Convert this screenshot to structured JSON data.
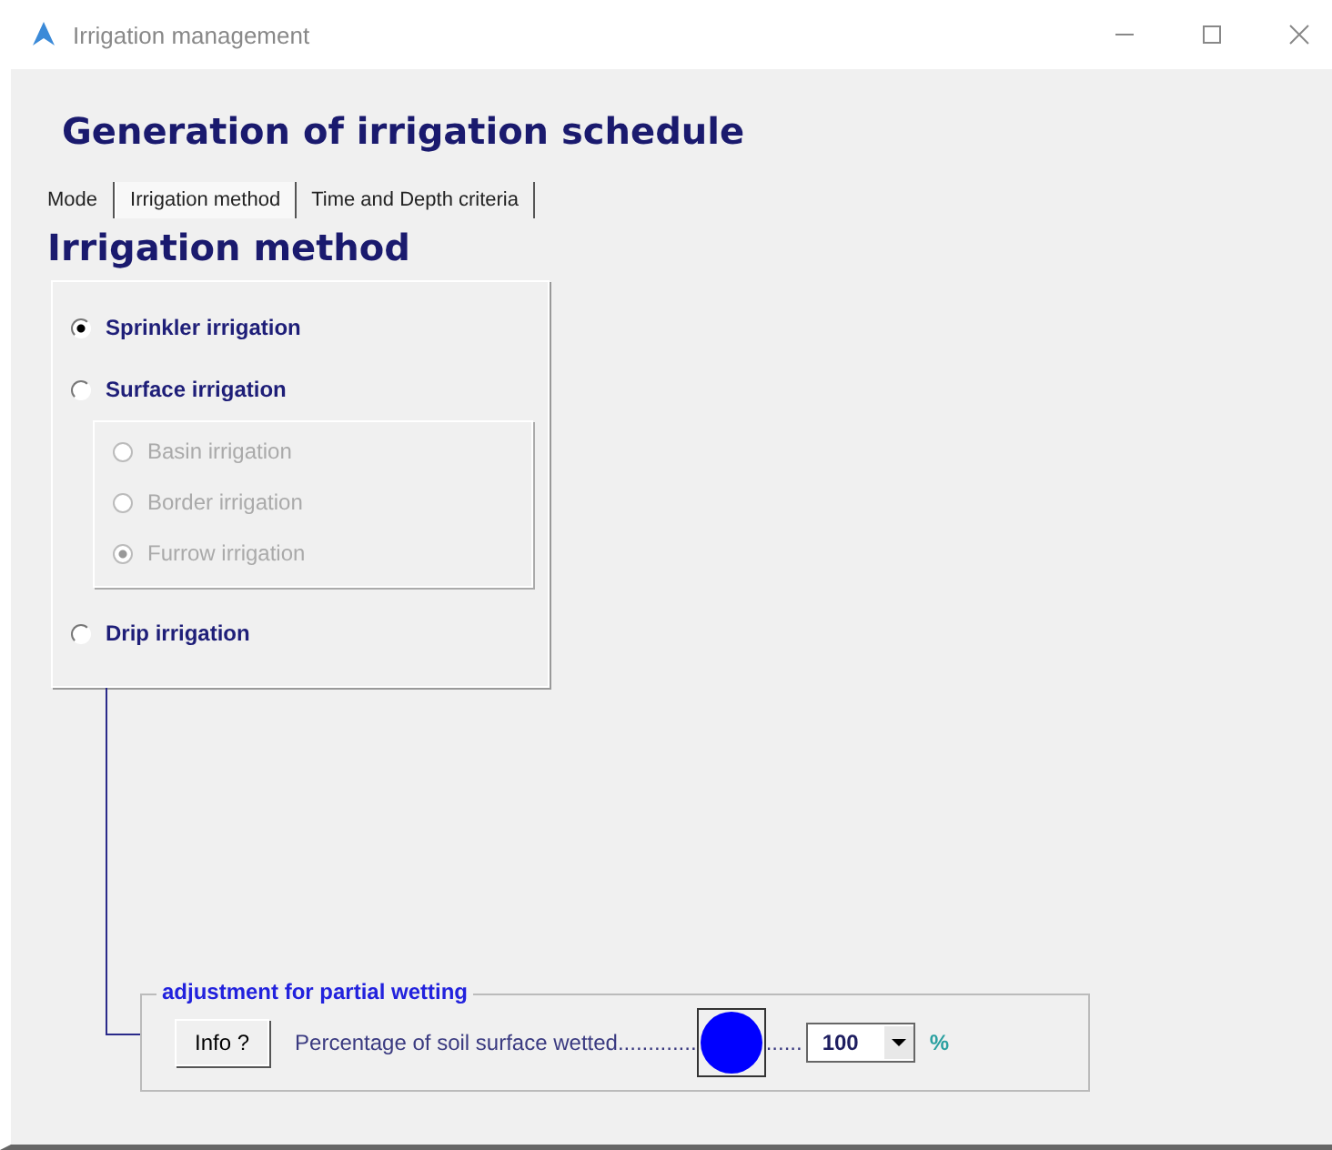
{
  "window": {
    "title": "Irrigation management"
  },
  "heading": "Generation of irrigation schedule",
  "tabs": [
    {
      "label": "Mode",
      "selected": false
    },
    {
      "label": "Irrigation method",
      "selected": true
    },
    {
      "label": "Time and Depth criteria",
      "selected": false
    }
  ],
  "section_title": "Irrigation method",
  "methods": [
    {
      "label": "Sprinkler irrigation",
      "selected": true
    },
    {
      "label": "Surface irrigation",
      "selected": false,
      "children": [
        {
          "label": "Basin irrigation",
          "selected": false,
          "disabled": true
        },
        {
          "label": "Border irrigation",
          "selected": false,
          "disabled": true
        },
        {
          "label": "Furrow irrigation",
          "selected": true,
          "disabled": true
        }
      ]
    },
    {
      "label": "Drip irrigation",
      "selected": false
    }
  ],
  "wetting": {
    "title": "adjustment for partial wetting",
    "info_button": "Info ?",
    "label": "Percentage of soil surface wetted.............",
    "trail": "......",
    "value": "100",
    "unit": "%"
  }
}
